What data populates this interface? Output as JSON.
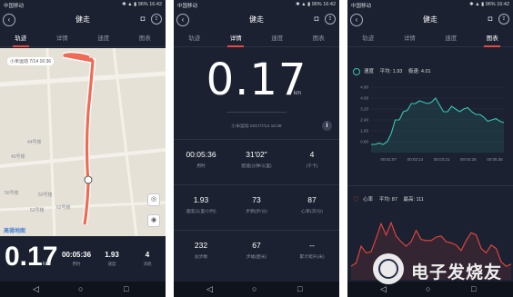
{
  "status_bar": {
    "carrier": "中国移动",
    "battery": "96%",
    "time": "16:42"
  },
  "app": {
    "title": "健走"
  },
  "tabs": [
    "轨迹",
    "详情",
    "速度",
    "图表"
  ],
  "nav": {
    "back": "◁",
    "home": "○",
    "recent": "□"
  },
  "map_screen": {
    "labels": [
      {
        "text": "小米运动 7/14 16:36"
      },
      {
        "text": "44号楼"
      },
      {
        "text": "45号楼"
      },
      {
        "text": "56号楼"
      },
      {
        "text": "50号楼"
      },
      {
        "text": "52号楼"
      },
      {
        "text": "62号楼"
      }
    ],
    "provider": "高德地图",
    "summary": {
      "distance": "0.17",
      "distance_unit": "km",
      "stats": [
        {
          "value": "00:05:36",
          "label": "用时"
        },
        {
          "value": "1.93",
          "label": "速度"
        },
        {
          "value": "4",
          "label": "消耗"
        }
      ]
    }
  },
  "detail_screen": {
    "distance": "0.17",
    "unit": "km",
    "meta": "小米运动    2017/7/14 16:36",
    "stats": [
      {
        "value": "00:05:36",
        "label": "用时"
      },
      {
        "value": "31'02\"",
        "label": "配速(分钟/公里)"
      },
      {
        "value": "4",
        "label": "(千卡)"
      },
      {
        "value": "1.93",
        "label": "速度(公里/小时)"
      },
      {
        "value": "73",
        "label": "步频(步/分)"
      },
      {
        "value": "87",
        "label": "心率(次/分)"
      },
      {
        "value": "232",
        "label": "总步数"
      },
      {
        "value": "67",
        "label": "步幅(厘米)"
      },
      {
        "value": "--",
        "label": "累计爬升(米)"
      }
    ]
  },
  "chart_screen": {
    "speed": {
      "title": "速度",
      "avg_label": "平均: 1.93",
      "max_label": "极速: 4.01"
    },
    "heart": {
      "title": "心率",
      "avg_label": "平均: 87",
      "max_label": "最高: 111"
    }
  },
  "chart_data": [
    {
      "type": "area",
      "title": "速度",
      "x": [
        "00:00",
        "00:01:07",
        "00:02:14",
        "00:03:21",
        "00:04:28",
        "00:05:36"
      ],
      "series": [
        {
          "name": "速度",
          "values": [
            0.6,
            0.6,
            0.7,
            0.6,
            0.8,
            1.4,
            2.4,
            2.4,
            3.0,
            3.1,
            3.6,
            3.6,
            3.8,
            3.7,
            3.6,
            3.7,
            4.0,
            3.5,
            3.0,
            3.0,
            3.4,
            3.2,
            3.0,
            3.2,
            3.3,
            3.0,
            2.8,
            2.8,
            2.6,
            2.3,
            2.4,
            2.5,
            2.3,
            2.2
          ]
        }
      ],
      "y_ticks": [
        "4.80",
        "4.00",
        "3.20",
        "2.40",
        "1.60",
        "0.80"
      ],
      "x_ticks": [
        "00:01:07",
        "00:02:14",
        "00:03:21",
        "00:04:28",
        "00:05:36"
      ],
      "ylim": [
        0,
        4.8
      ],
      "color": "#3bc4b3"
    },
    {
      "type": "area",
      "title": "心率",
      "series": [
        {
          "name": "心率",
          "values": [
            72,
            75,
            90,
            84,
            85,
            97,
            110,
            100,
            111,
            99,
            94,
            90,
            94,
            104,
            96,
            95,
            95,
            98,
            99,
            94,
            93,
            91,
            86,
            95,
            102,
            100,
            88,
            84,
            91,
            88,
            76,
            72,
            74
          ]
        }
      ],
      "ylim": [
        60,
        120
      ],
      "color": "#e8473f"
    }
  ],
  "watermark": "电子发烧友",
  "colors": {
    "accent": "#e8473f",
    "background": "#1b2130",
    "speed": "#3bc4b3"
  }
}
